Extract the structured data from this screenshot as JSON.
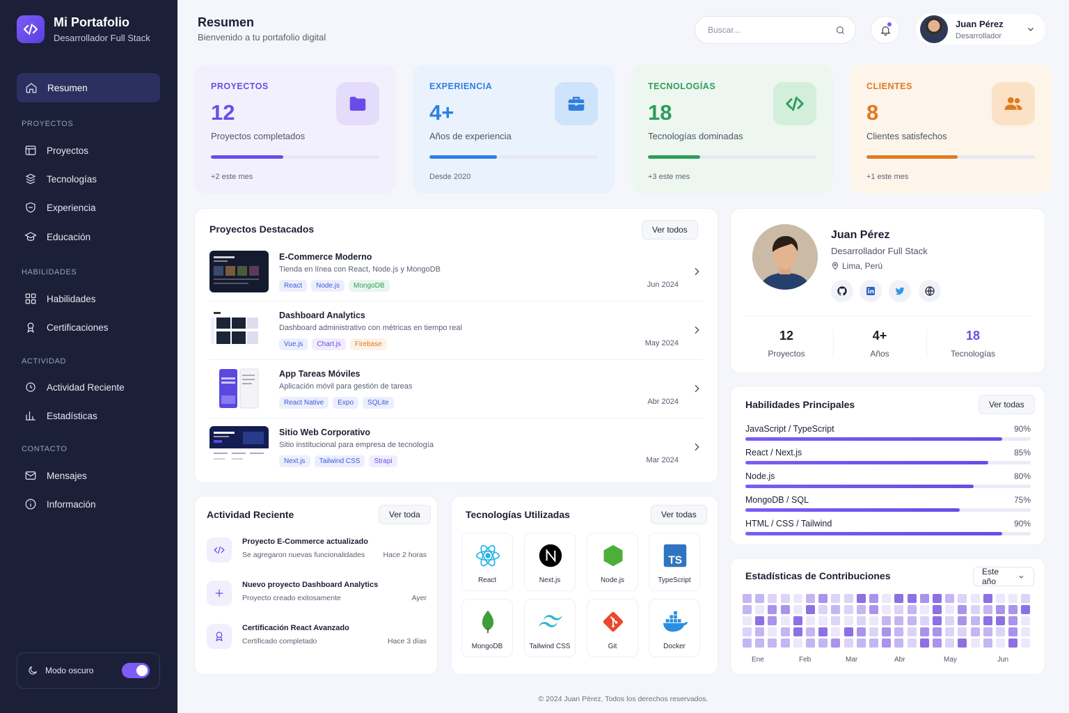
{
  "brand": {
    "title": "Mi Portafolio",
    "subtitle": "Desarrollador Full Stack"
  },
  "sidebar": {
    "active": {
      "label": "Resumen",
      "icon": "home-icon"
    },
    "sections": [
      {
        "title": "PROYECTOS",
        "items": [
          {
            "label": "Proyectos",
            "icon": "grid-icon"
          },
          {
            "label": "Tecnologías",
            "icon": "layers-icon"
          },
          {
            "label": "Experiencia",
            "icon": "briefcase-icon"
          },
          {
            "label": "Educación",
            "icon": "school-icon"
          }
        ]
      },
      {
        "title": "HABILIDADES",
        "items": [
          {
            "label": "Habilidades",
            "icon": "apps-icon"
          },
          {
            "label": "Certificaciones",
            "icon": "certificate-icon"
          }
        ]
      },
      {
        "title": "ACTIVIDAD",
        "items": [
          {
            "label": "Actividad Reciente",
            "icon": "activity-icon"
          },
          {
            "label": "Estadísticas",
            "icon": "chart-icon"
          }
        ]
      },
      {
        "title": "CONTACTO",
        "items": [
          {
            "label": "Mensajes",
            "icon": "mail-icon"
          },
          {
            "label": "Información",
            "icon": "info-icon"
          }
        ]
      }
    ],
    "dark_mode": {
      "label": "Modo oscuro",
      "enabled": true
    }
  },
  "header": {
    "title": "Resumen",
    "subtitle": "Bienvenido a tu portafolio digital",
    "search_placeholder": "Buscar...",
    "user": {
      "name": "Juan Pérez",
      "role": "Desarrollador"
    }
  },
  "stats": [
    {
      "label": "PROYECTOS",
      "value": "12",
      "desc": "Proyectos completados",
      "foot": "+2 este mes",
      "progress": 0.43,
      "color": "#6a4ce8",
      "bg": "#f3f0fd",
      "icon_bg": "#e3dcfb",
      "icon": "folder-icon"
    },
    {
      "label": "EXPERIENCIA",
      "value": "4+",
      "desc": "Años de experiencia",
      "foot": "Desde 2020",
      "progress": 0.4,
      "color": "#2f7fe0",
      "bg": "#eaf3fd",
      "icon_bg": "#cfe3fb",
      "icon": "briefcase-icon"
    },
    {
      "label": "TECNOLOGÍAS",
      "value": "18",
      "desc": "Tecnologías dominadas",
      "foot": "+3 este mes",
      "progress": 0.31,
      "color": "#2f9d5a",
      "bg": "#edf7f0",
      "icon_bg": "#d4eedc",
      "icon": "code-icon"
    },
    {
      "label": "CLIENTES",
      "value": "8",
      "desc": "Clientes satisfechos",
      "foot": "+1 este mes",
      "progress": 0.54,
      "color": "#e07a1f",
      "bg": "#fdf4ea",
      "icon_bg": "#fbe2c6",
      "icon": "users-icon"
    }
  ],
  "projects": {
    "title": "Proyectos Destacados",
    "view_all": "Ver todos",
    "items": [
      {
        "title": "E-Commerce Moderno",
        "desc": "Tienda en línea con React, Node.js y MongoDB",
        "date": "Jun 2024",
        "tags": [
          {
            "t": "React",
            "c": "#3d5bd9",
            "b": "#ebeffd"
          },
          {
            "t": "Node.js",
            "c": "#3d5bd9",
            "b": "#ebeffd"
          },
          {
            "t": "MongoDB",
            "c": "#2f9d5a",
            "b": "#e8f6ed"
          }
        ]
      },
      {
        "title": "Dashboard Analytics",
        "desc": "Dashboard administrativo con métricas en tiempo real",
        "date": "May 2024",
        "tags": [
          {
            "t": "Vue.js",
            "c": "#3d5bd9",
            "b": "#ebeffd"
          },
          {
            "t": "Chart.js",
            "c": "#6a4ce8",
            "b": "#f1edfd"
          },
          {
            "t": "Firebase",
            "c": "#e07a1f",
            "b": "#fdf2e6"
          }
        ]
      },
      {
        "title": "App Tareas Móviles",
        "desc": "Aplicación móvil para gestión de tareas",
        "date": "Abr 2024",
        "tags": [
          {
            "t": "React Native",
            "c": "#3d5bd9",
            "b": "#ebeffd"
          },
          {
            "t": "Expo",
            "c": "#3d5bd9",
            "b": "#ebeffd"
          },
          {
            "t": "SQLite",
            "c": "#3d5bd9",
            "b": "#ebeffd"
          }
        ]
      },
      {
        "title": "Sitio Web Corporativo",
        "desc": "Sitio institucional para empresa de tecnología",
        "date": "Mar 2024",
        "tags": [
          {
            "t": "Next.js",
            "c": "#3d5bd9",
            "b": "#ebeffd"
          },
          {
            "t": "Tailwind CSS",
            "c": "#3d5bd9",
            "b": "#ebeffd"
          },
          {
            "t": "Strapi",
            "c": "#6a4ce8",
            "b": "#f1edfd"
          }
        ]
      }
    ]
  },
  "profile": {
    "name": "Juan Pérez",
    "role": "Desarrollador Full Stack",
    "location": "Lima, Perú",
    "social": [
      "github-icon",
      "linkedin-icon",
      "twitter-icon",
      "globe-icon"
    ],
    "stats": [
      {
        "value": "12",
        "label": "Proyectos",
        "color": "#1b1f33"
      },
      {
        "value": "4+",
        "label": "Años",
        "color": "#1b1f33"
      },
      {
        "value": "18",
        "label": "Tecnologías",
        "color": "#6a4ce8"
      }
    ]
  },
  "skills": {
    "title": "Habilidades Principales",
    "view_all": "Ver todas",
    "items": [
      {
        "name": "JavaScript / TypeScript",
        "value": "90%",
        "level": 0.9
      },
      {
        "name": "React / Next.js",
        "value": "85%",
        "level": 0.85
      },
      {
        "name": "Node.js",
        "value": "80%",
        "level": 0.8
      },
      {
        "name": "MongoDB / SQL",
        "value": "75%",
        "level": 0.75
      },
      {
        "name": "HTML / CSS / Tailwind",
        "value": "90%",
        "level": 0.9
      }
    ]
  },
  "activity": {
    "title": "Actividad Reciente",
    "view_all": "Ver toda",
    "items": [
      {
        "title": "Proyecto E-Commerce actualizado",
        "desc": "Se agregaron nuevas funcionalidades",
        "when": "Hace 2 horas",
        "icon": "code-icon"
      },
      {
        "title": "Nuevo proyecto Dashboard Analytics",
        "desc": "Proyecto creado exitosamente",
        "when": "Ayer",
        "icon": "plus-icon"
      },
      {
        "title": "Certificación React Avanzado",
        "desc": "Certificado completado",
        "when": "Hace 3 días",
        "icon": "award-icon"
      }
    ]
  },
  "tech": {
    "title": "Tecnologías Utilizadas",
    "view_all": "Ver todas",
    "items": [
      "React",
      "Next.js",
      "Node.js",
      "TypeScript",
      "MongoDB",
      "Tailwind CSS",
      "Git",
      "Docker"
    ]
  },
  "contributions": {
    "title": "Estadísticas de Contribuciones",
    "period": "Este año",
    "months": [
      "Ene",
      "Feb",
      "Mar",
      "Abr",
      "May",
      "Jun"
    ]
  },
  "footer": "© 2024 Juan Pérez. Todos los derechos reservados."
}
